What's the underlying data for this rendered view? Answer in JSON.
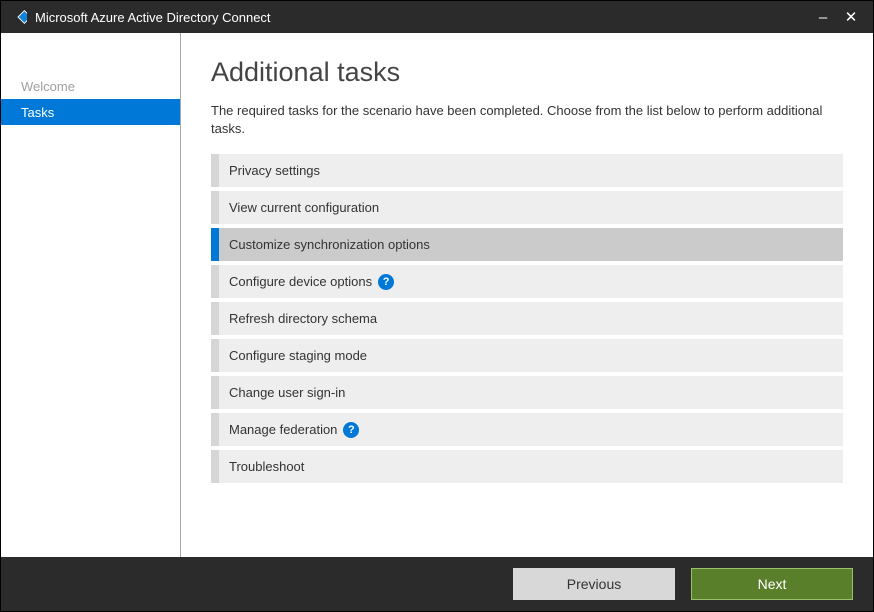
{
  "window": {
    "title": "Microsoft Azure Active Directory Connect"
  },
  "sidebar": {
    "items": [
      {
        "label": "Welcome",
        "active": false
      },
      {
        "label": "Tasks",
        "active": true
      }
    ]
  },
  "main": {
    "heading": "Additional tasks",
    "description": "The required tasks for the scenario have been completed. Choose from the list below to perform additional tasks.",
    "tasks": [
      {
        "label": "Privacy settings",
        "selected": false,
        "help": false
      },
      {
        "label": "View current configuration",
        "selected": false,
        "help": false
      },
      {
        "label": "Customize synchronization options",
        "selected": true,
        "help": false
      },
      {
        "label": "Configure device options",
        "selected": false,
        "help": true
      },
      {
        "label": "Refresh directory schema",
        "selected": false,
        "help": false
      },
      {
        "label": "Configure staging mode",
        "selected": false,
        "help": false
      },
      {
        "label": "Change user sign-in",
        "selected": false,
        "help": false
      },
      {
        "label": "Manage federation",
        "selected": false,
        "help": true
      },
      {
        "label": "Troubleshoot",
        "selected": false,
        "help": false
      }
    ]
  },
  "footer": {
    "previous_label": "Previous",
    "next_label": "Next"
  }
}
